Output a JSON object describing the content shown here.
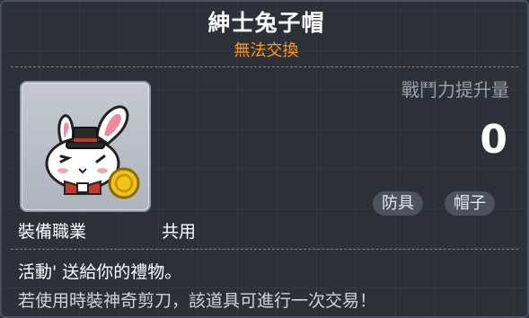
{
  "item": {
    "name": "紳士兔子帽",
    "trade_status": "無法交換",
    "icon": "gentleman-rabbit-hat-icon"
  },
  "stats": {
    "label": "戰鬥力提升量",
    "value": "0"
  },
  "tags": {
    "armor": "防具",
    "hat": "帽子"
  },
  "job": {
    "label": "裝備職業",
    "value": "共用"
  },
  "description": {
    "line1": "活動' 送給你的禮物。",
    "line2": "若使用時裝神奇剪刀，該道具可進行一次交易！"
  },
  "colors": {
    "title": "#ffffff",
    "trade_status": "#ff9a1a",
    "stat_label": "#9aa0ab",
    "background": "#2b3039"
  }
}
